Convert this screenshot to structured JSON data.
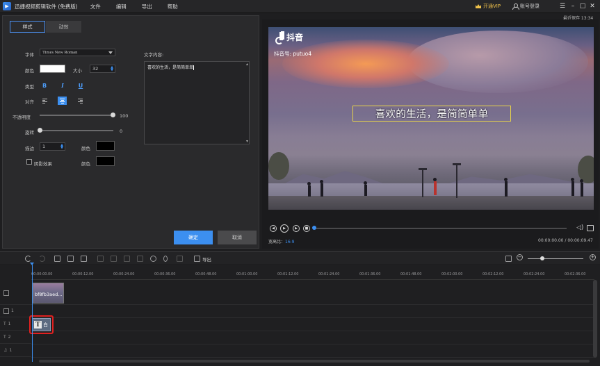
{
  "app": {
    "title": "迅捷视频剪辑软件 (免费版)",
    "menu": [
      "文件",
      "编辑",
      "导出",
      "帮助"
    ],
    "vip_label": "开通VIP",
    "login_label": "账号登录",
    "last_saved": "最近保存 13:34"
  },
  "editor": {
    "tabs": [
      "样式",
      "动效"
    ],
    "font_label": "字体",
    "font_value": "Times New Roman",
    "color_label": "颜色",
    "color_value": "#ffffff",
    "size_label": "大小",
    "size_value": "32",
    "type_label": "类型",
    "bold": "B",
    "italic": "I",
    "underline": "U",
    "align_label": "对齐",
    "opacity_label": "不透明度",
    "opacity_value": "100",
    "rotate_label": "旋转",
    "rotate_value": "0",
    "stroke_label": "描边",
    "stroke_value": "1",
    "stroke_color_label": "颜色",
    "shadow_label": "阴影效果",
    "shadow_color_label": "颜色",
    "text_content_label": "文字内容:",
    "text_content": "喜欢的生活，是简简单单",
    "ok_label": "确定",
    "cancel_label": "取消"
  },
  "preview": {
    "tiktok_name": "抖音",
    "tiktok_id": "抖音号: putuo4",
    "caption": "喜欢的生活，是简简单单",
    "aspect_label": "宽高比：",
    "aspect_value": "16:9",
    "time": "00:00:00.00 / 00:00:09.47",
    "progress": 0
  },
  "timeline": {
    "export_label": "导出",
    "ticks": [
      "00:00:00.00",
      "00:00:12.00",
      "00:00:24.00",
      "00:00:36.00",
      "00:00:48.00",
      "00:01:00.00",
      "00:01:12.00",
      "00:01:24.00",
      "00:01:36.00",
      "00:01:48.00",
      "00:02:00.00",
      "00:02:12.00",
      "00:02:24.00",
      "00:02:36.00"
    ],
    "track_labels": [
      "1",
      "1",
      "2",
      "1"
    ],
    "video_clip_label": "bf8fb3aed...",
    "text_clip_label": "白"
  }
}
